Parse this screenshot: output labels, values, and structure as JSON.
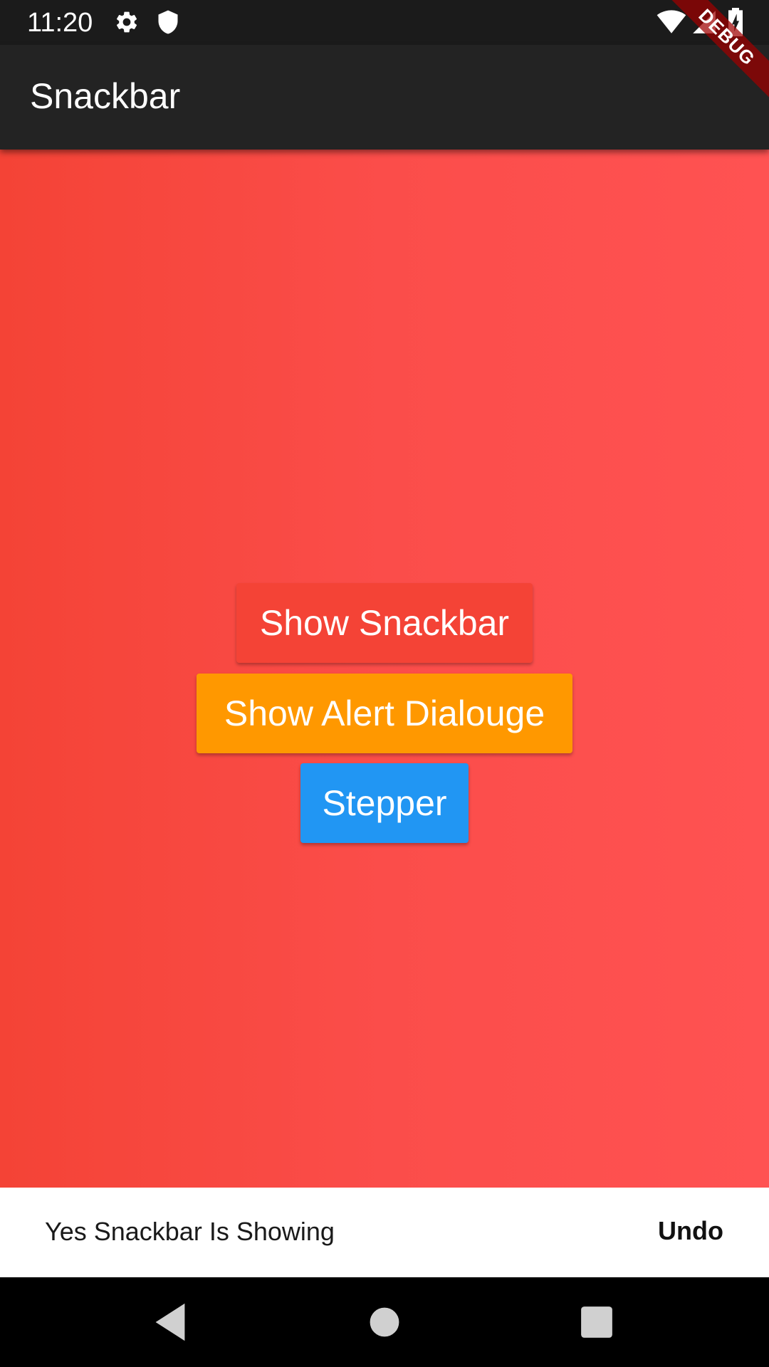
{
  "status_bar": {
    "time": "11:20",
    "icons": [
      "settings-icon",
      "shield-icon",
      "wifi-icon",
      "signal-icon",
      "battery-charging-icon"
    ]
  },
  "app_bar": {
    "title": "Snackbar"
  },
  "debug_banner": {
    "label": "DEBUG"
  },
  "buttons": {
    "show_snackbar": "Show Snackbar",
    "show_alert": "Show Alert Dialouge",
    "stepper": "Stepper"
  },
  "snackbar": {
    "message": "Yes Snackbar Is Showing",
    "action": "Undo"
  },
  "nav_bar": {
    "icons": [
      "back-icon",
      "home-icon",
      "recents-icon"
    ]
  },
  "colors": {
    "status_bar": "#1b1b1b",
    "app_bar": "#232323",
    "background_gradient_start": "#f44336",
    "background_gradient_end": "#ff5252",
    "snackbar_button": "#f44336",
    "alert_button": "#ff9800",
    "stepper_button": "#2196f3",
    "snackbar_background": "#ffffff"
  }
}
